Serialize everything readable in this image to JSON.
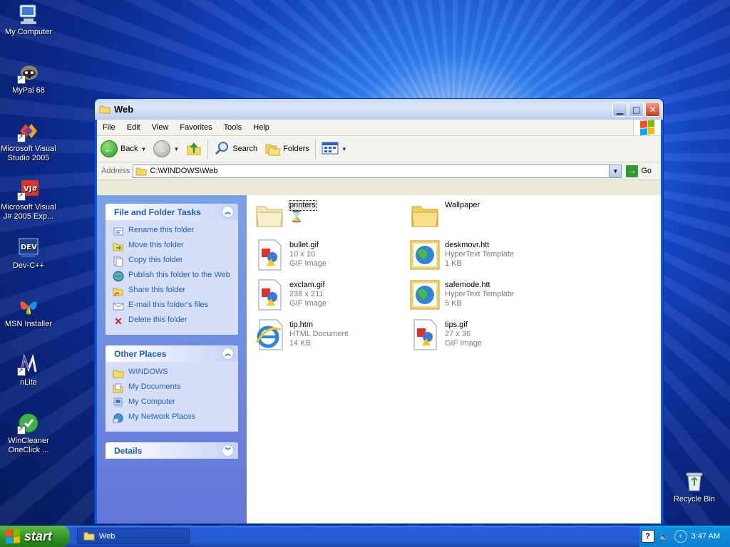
{
  "desktop": {
    "icons": [
      {
        "label": "My Computer",
        "icon": "my-computer-icon"
      },
      {
        "label": "MyPal 68",
        "icon": "mypal-raccoon-icon"
      },
      {
        "label": "Microsoft Visual Studio 2005",
        "icon": "visual-studio-icon"
      },
      {
        "label": "Microsoft Visual J# 2005 Exp...",
        "icon": "visual-jsharp-icon"
      },
      {
        "label": "Dev-C++",
        "icon": "dev-cpp-icon"
      },
      {
        "label": "MSN Installer",
        "icon": "msn-butterfly-icon"
      },
      {
        "label": "nLite",
        "icon": "nlite-icon"
      },
      {
        "label": "WinCleaner OneClick ...",
        "icon": "wincleaner-icon"
      },
      {
        "label": "Recycle Bin",
        "icon": "recycle-bin-icon"
      }
    ]
  },
  "window": {
    "title": "Web",
    "menu": [
      "File",
      "Edit",
      "View",
      "Favorites",
      "Tools",
      "Help"
    ],
    "toolbar": {
      "back": "Back",
      "search": "Search",
      "folders": "Folders"
    },
    "address": {
      "label": "Address",
      "value": "C:\\WINDOWS\\Web",
      "go": "Go"
    }
  },
  "taskpane": {
    "file_tasks": {
      "title": "File and Folder Tasks",
      "items": [
        "Rename this folder",
        "Move this folder",
        "Copy this folder",
        "Publish this folder to the Web",
        "Share this folder",
        "E-mail this folder's files",
        "Delete this folder"
      ]
    },
    "other_places": {
      "title": "Other Places",
      "items": [
        "WINDOWS",
        "My Documents",
        "My Computer",
        "My Network Places"
      ]
    },
    "details": {
      "title": "Details"
    }
  },
  "files": [
    {
      "name": "printers",
      "line2": "",
      "line3": "",
      "type": "folder"
    },
    {
      "name": "Wallpaper",
      "line2": "",
      "line3": "",
      "type": "folder"
    },
    {
      "name": "bullet.gif",
      "line2": "10 x 10",
      "line3": "GIF Image",
      "type": "gif"
    },
    {
      "name": "deskmovr.htt",
      "line2": "HyperText Template",
      "line3": "1 KB",
      "type": "htt"
    },
    {
      "name": "exclam.gif",
      "line2": "238 x 211",
      "line3": "GIF Image",
      "type": "gif"
    },
    {
      "name": "safemode.htt",
      "line2": "HyperText Template",
      "line3": "5 KB",
      "type": "htt"
    },
    {
      "name": "tip.htm",
      "line2": "HTML Document",
      "line3": "14 KB",
      "type": "htm"
    },
    {
      "name": "tips.gif",
      "line2": "27 x 36",
      "line3": "GIF Image",
      "type": "gif"
    }
  ],
  "taskbar": {
    "start": "start",
    "task_item": "Web",
    "clock": "3:47 AM"
  },
  "colors": {
    "xp_blue": "#0a58e4",
    "task_link": "#215dc6",
    "start_green": "#2f8f21"
  }
}
